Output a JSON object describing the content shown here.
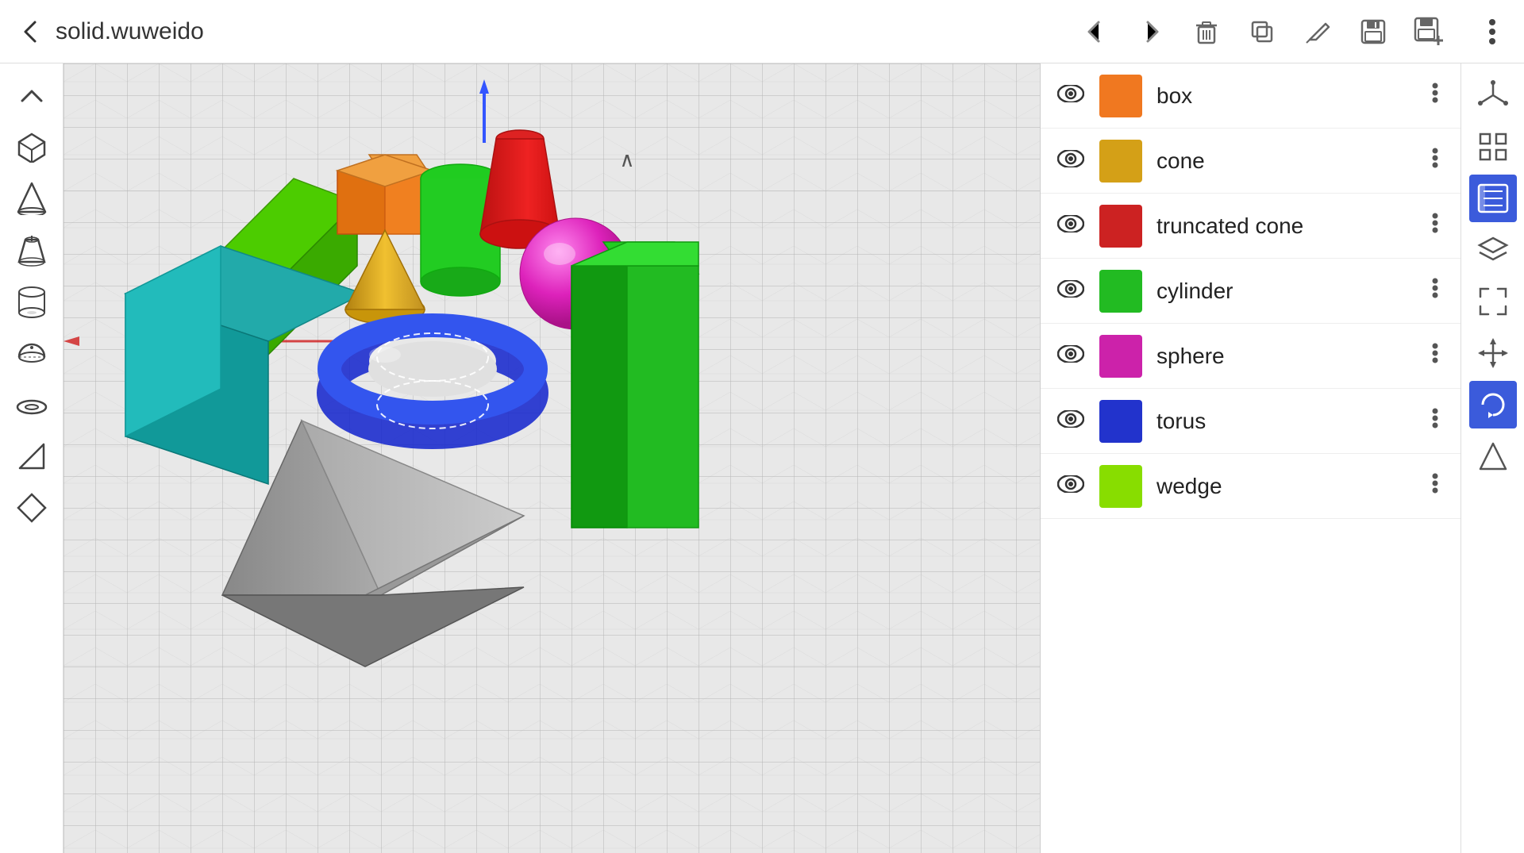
{
  "header": {
    "title": "solid.wuweido",
    "back_label": "‹",
    "nav": {
      "back": "←",
      "forward": "→",
      "delete": "🗑",
      "copy": "⧉",
      "edit": "✏",
      "save": "💾",
      "save_plus": "💾+"
    },
    "more_label": "⋮"
  },
  "left_sidebar": {
    "items": [
      {
        "name": "collapse-up",
        "icon": "∧",
        "label": "collapse"
      },
      {
        "name": "cube",
        "icon": "cube",
        "label": "box"
      },
      {
        "name": "cone",
        "icon": "cone",
        "label": "cone"
      },
      {
        "name": "truncated-cone",
        "icon": "tcone",
        "label": "truncated cone"
      },
      {
        "name": "cylinder",
        "icon": "cyl",
        "label": "cylinder"
      },
      {
        "name": "sphere-half",
        "icon": "sphere",
        "label": "sphere"
      },
      {
        "name": "torus",
        "icon": "torus",
        "label": "torus"
      },
      {
        "name": "send",
        "icon": "send",
        "label": "send"
      },
      {
        "name": "diamond",
        "icon": "diamond",
        "label": "diamond"
      }
    ]
  },
  "right_sidebar": {
    "items": [
      {
        "name": "axis-view",
        "icon": "axis",
        "label": "axis view",
        "active": false
      },
      {
        "name": "zoom-fit",
        "icon": "zoom-fit",
        "label": "zoom fit",
        "active": false
      },
      {
        "name": "properties-panel",
        "icon": "panel",
        "label": "properties panel",
        "active": true
      },
      {
        "name": "layers",
        "icon": "layers",
        "label": "layers",
        "active": false
      },
      {
        "name": "expand",
        "icon": "expand",
        "label": "expand",
        "active": false
      },
      {
        "name": "move",
        "icon": "move",
        "label": "move",
        "active": false
      },
      {
        "name": "rotate",
        "icon": "rotate",
        "label": "rotate",
        "active": true
      },
      {
        "name": "transform",
        "icon": "transform",
        "label": "transform",
        "active": false
      }
    ]
  },
  "panel": {
    "header_icon": "≡",
    "eye_icon": "👁",
    "close_eye_icon": "~",
    "items": [
      {
        "name": "box",
        "label": "box",
        "color": "#f07820",
        "visible": true
      },
      {
        "name": "cone",
        "label": "cone",
        "color": "#d4a017",
        "visible": true
      },
      {
        "name": "truncated-cone",
        "label": "truncated cone",
        "color": "#cc2222",
        "visible": true
      },
      {
        "name": "cylinder",
        "label": "cylinder",
        "color": "#22bb22",
        "visible": true
      },
      {
        "name": "sphere",
        "label": "sphere",
        "color": "#cc22aa",
        "visible": true
      },
      {
        "name": "torus",
        "label": "torus",
        "color": "#2233cc",
        "visible": true
      },
      {
        "name": "wedge",
        "label": "wedge",
        "color": "#88dd00",
        "visible": true
      }
    ]
  },
  "viewport": {
    "top_arrow": "∧"
  }
}
